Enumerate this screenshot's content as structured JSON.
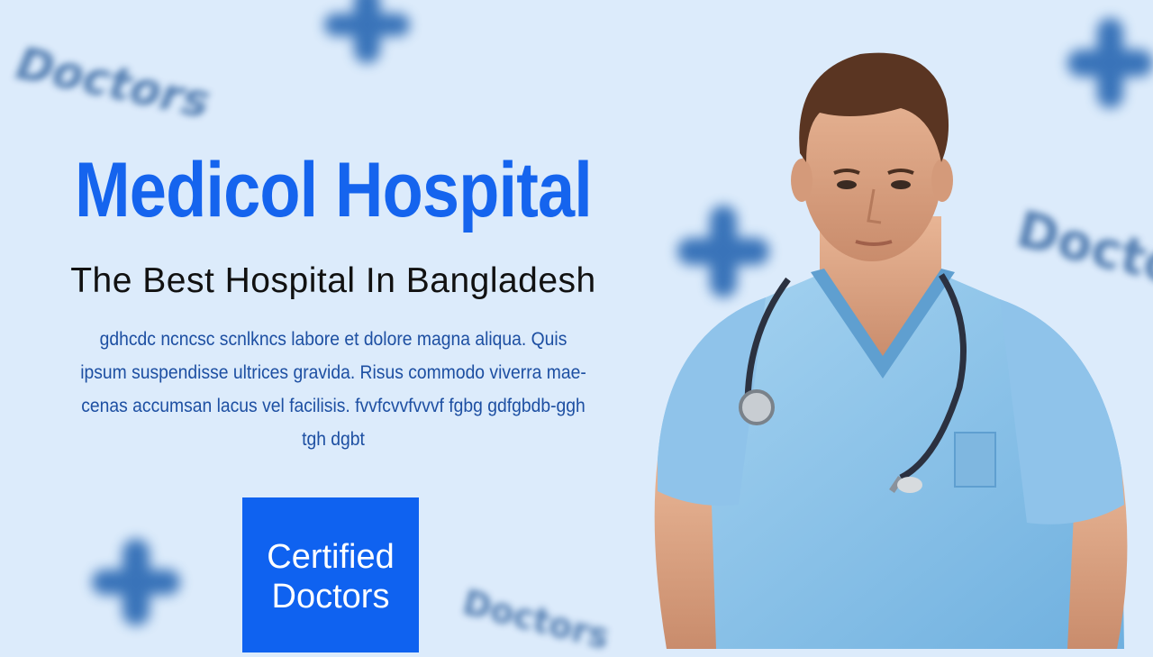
{
  "hero": {
    "title": "Medicol Hospital",
    "subtitle": "The Best Hospital In Bangladesh",
    "description": "gdhcdc ncncsc scnlkncs labore et dolore magna aliqua. Quis ipsum suspendisse ultrices gravida. Risus commodo viverra mae-cenas accumsan lacus vel facilisis.   fvvfcvvfvvvf fgbg gdfgbdb-ggh tgh dgbt"
  },
  "badge": {
    "line1": "Certified",
    "line2": "Doctors"
  },
  "decor_word": "Doctors",
  "colors": {
    "accent": "#1564ee",
    "badge": "#0f62f0",
    "background": "#dcebfb",
    "body_text": "#1d4fa2",
    "scrubs": "#8cc4ea"
  },
  "icons": [
    "medical-cross-icon",
    "stethoscope-icon"
  ]
}
